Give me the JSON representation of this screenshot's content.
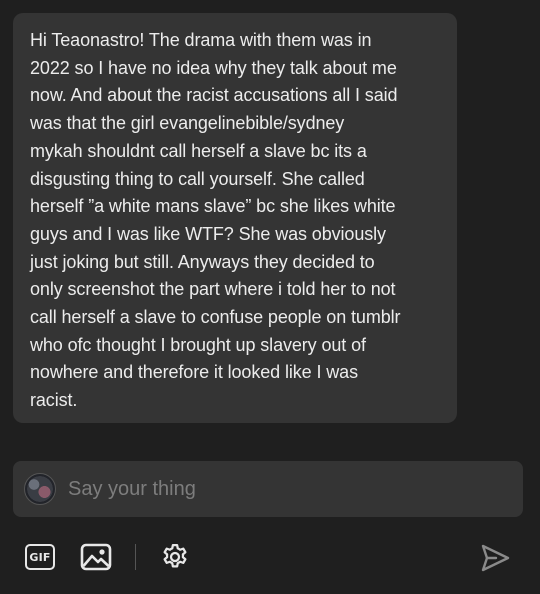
{
  "message": {
    "text": "Hi Teaonastro! The drama with them was in\n2022 so I have no idea why they talk about me\nnow. And about the racist accusations all I said\nwas that the girl evangelinebible/sydney\nmykah shouldnt call herself a slave bc its a\ndisgusting thing to call yourself. She called\nherself ”a white mans slave” bc she likes white\nguys and I was like WTF? She was obviously\njust joking but still. Anyways they decided to\nonly screenshot the part where i told her to not\ncall herself a slave to confuse people on tumblr\nwho ofc thought I brought up slavery out of\nnowhere and therefore it looked like I was\nracist."
  },
  "composer": {
    "placeholder": "Say your thing",
    "value": ""
  },
  "toolbar": {
    "gif_label": "GIF",
    "icons": [
      "gif-icon",
      "image-icon",
      "gear-icon",
      "send-icon"
    ]
  },
  "colors": {
    "background": "#1f1f1f",
    "bubble": "#343434",
    "text": "#ececec",
    "placeholder": "#7d7d7d",
    "icon": "#e8e8e8",
    "send_icon": "#8a8a8a"
  }
}
